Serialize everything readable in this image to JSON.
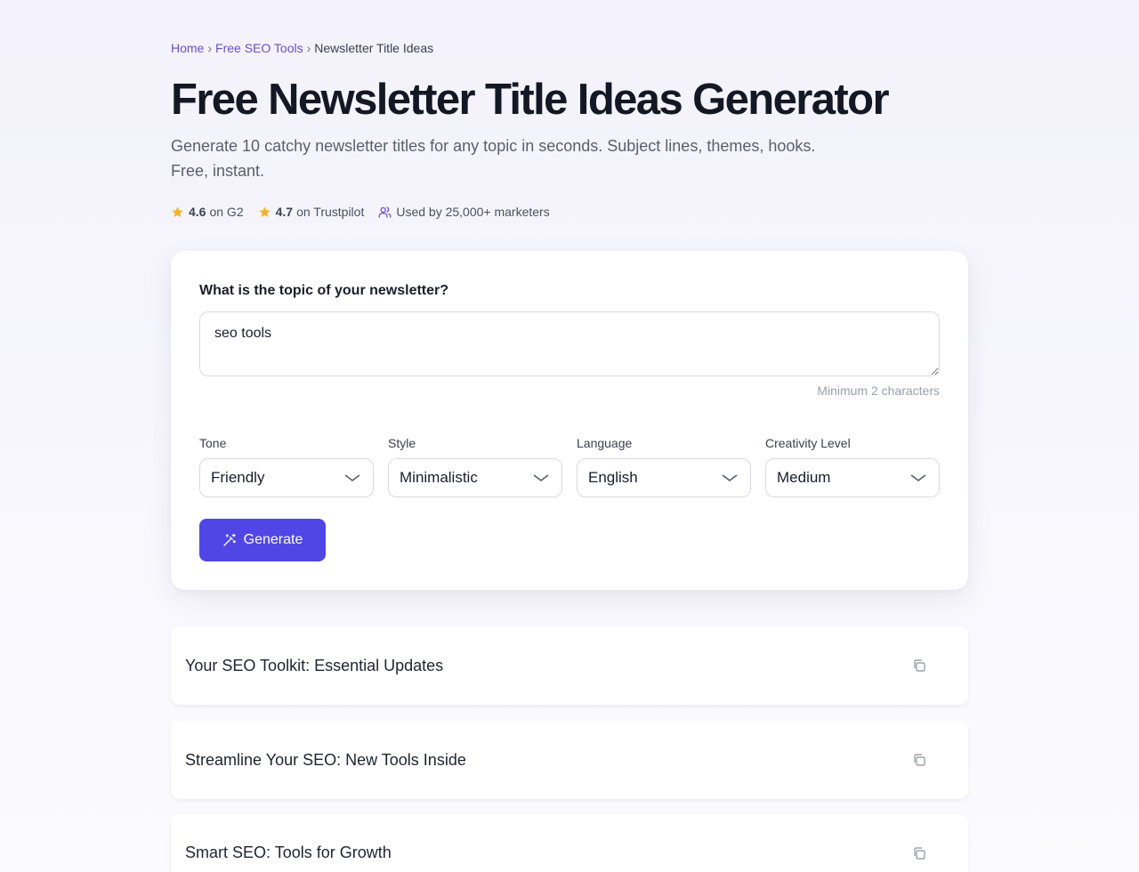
{
  "breadcrumb": {
    "home": "Home",
    "tools": "Free SEO Tools",
    "current": "Newsletter Title Ideas",
    "separator": "›"
  },
  "title": "Free Newsletter Title Ideas Generator",
  "subtitle": "Generate 10 catchy newsletter titles for any topic in seconds. Subject lines, themes, hooks. Free, instant.",
  "ratings": {
    "g2": {
      "score": "4.6",
      "label": "on G2"
    },
    "trustpilot": {
      "score": "4.7",
      "label": "on Trustpilot"
    },
    "usage": "Used by 25,000+ marketers",
    "star_color": "#f0b429",
    "icons": [
      "star-icon",
      "star-icon",
      "users-icon"
    ]
  },
  "form": {
    "question": "What is the topic of your newsletter?",
    "topic_value": "seo tools",
    "hint": "Minimum 2 characters",
    "fields": {
      "tone": {
        "label": "Tone",
        "value": "Friendly"
      },
      "style": {
        "label": "Style",
        "value": "Minimalistic"
      },
      "language": {
        "label": "Language",
        "value": "English"
      },
      "creativity": {
        "label": "Creativity Level",
        "value": "Medium"
      }
    },
    "generate_label": "Generate",
    "accent_color": "#5046e5"
  },
  "results": [
    {
      "title": "Your SEO Toolkit: Essential Updates",
      "icon": "copy-icon"
    },
    {
      "title": "Streamline Your SEO: New Tools Inside",
      "icon": "copy-icon"
    },
    {
      "title": "Smart SEO: Tools for Growth",
      "icon": "copy-icon"
    }
  ]
}
